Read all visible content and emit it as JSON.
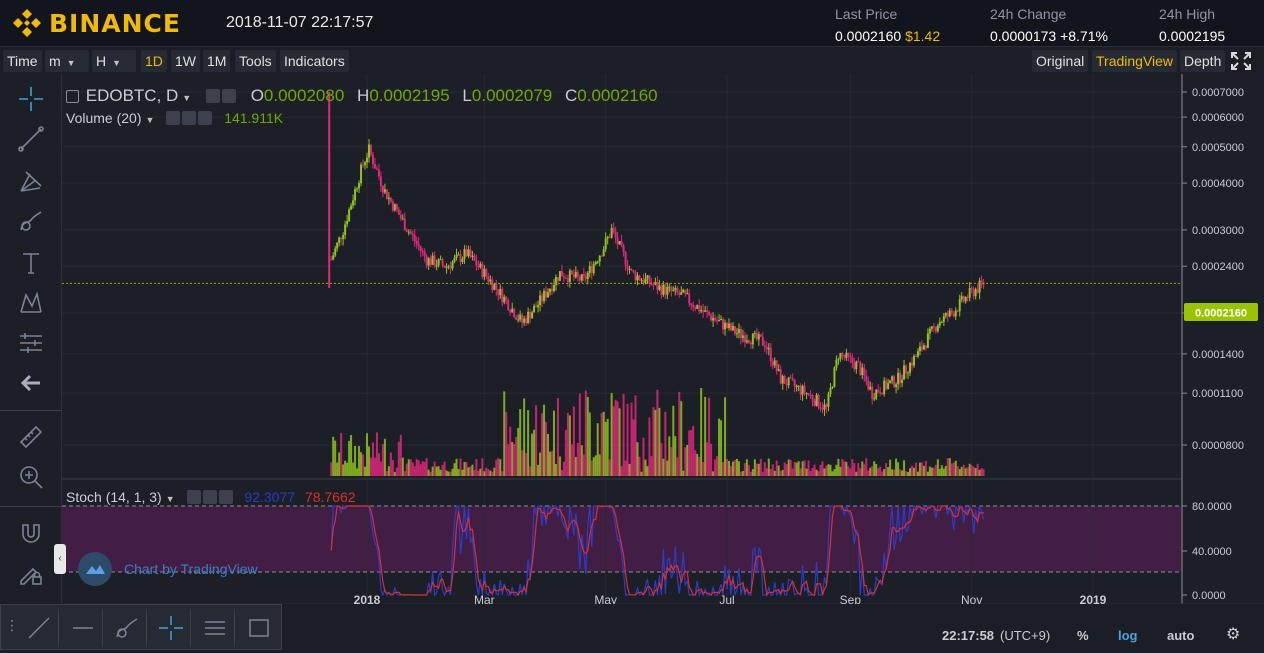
{
  "header": {
    "brand": "BINANCE",
    "datetime": "2018-11-07 22:17:57",
    "last_price_label": "Last Price",
    "last_price": "0.0002160",
    "last_price_usd": "$1.42",
    "change_label": "24h Change",
    "change_value": "0.0000173",
    "change_pct": "+8.71%",
    "high_label": "24h High",
    "high_value": "0.0002195",
    "colors": {
      "brand": "#f0b90b",
      "up": "#70a800",
      "down": "#e0287d"
    }
  },
  "toolbar": {
    "time_label": "Time",
    "minute_label": "m",
    "hour_label": "H",
    "intervals": [
      "1D",
      "1W",
      "1M"
    ],
    "active_interval": "1D",
    "tools_label": "Tools",
    "indicators_label": "Indicators",
    "views": [
      "Original",
      "TradingView",
      "Depth"
    ],
    "active_view": "TradingView"
  },
  "legend": {
    "symbol": "EDOBTC, D",
    "o_label": "O",
    "o_value": "0.0002080",
    "h_label": "H",
    "h_value": "0.0002195",
    "l_label": "L",
    "l_value": "0.0002079",
    "c_label": "C",
    "c_value": "0.0002160",
    "volume_label": "Volume (20)",
    "volume_value": "141.911K",
    "stoch_label": "Stoch (14, 1, 3)",
    "stoch_k": "92.3077",
    "stoch_d": "78.7662"
  },
  "chart_data": {
    "type": "candlestick",
    "price_scale": "log",
    "price_axis_ticks": [
      "0.0007000",
      "0.0006000",
      "0.0005000",
      "0.0004000",
      "0.0003000",
      "0.0002400",
      "0.0001800",
      "0.0001400",
      "0.0001100",
      "0.0000800"
    ],
    "current_price_label": "0.0002160",
    "stoch_axis_ticks": [
      "80.0000",
      "40.0000",
      "0.0000"
    ],
    "time_ticks": [
      "2018",
      "Mar",
      "May",
      "Jul",
      "Sep",
      "Nov",
      "2019"
    ],
    "price_path": [
      [
        "2017-12-13",
        0.0007
      ],
      [
        "2017-12-14",
        0.00025
      ],
      [
        "2017-12-20",
        0.0003
      ],
      [
        "2017-12-30",
        0.00045
      ],
      [
        "2018-01-02",
        0.00049
      ],
      [
        "2018-01-10",
        0.00038
      ],
      [
        "2018-01-20",
        0.00031
      ],
      [
        "2018-01-31",
        0.00025
      ],
      [
        "2018-02-10",
        0.00024
      ],
      [
        "2018-02-20",
        0.00026
      ],
      [
        "2018-03-01",
        0.00023
      ],
      [
        "2018-03-10",
        0.0002
      ],
      [
        "2018-03-20",
        0.00017
      ],
      [
        "2018-03-28",
        0.00019
      ],
      [
        "2018-04-08",
        0.00023
      ],
      [
        "2018-04-20",
        0.00022
      ],
      [
        "2018-04-30",
        0.00027
      ],
      [
        "2018-05-04",
        0.0003
      ],
      [
        "2018-05-14",
        0.00023
      ],
      [
        "2018-05-28",
        0.00021
      ],
      [
        "2018-06-09",
        0.0002
      ],
      [
        "2018-06-20",
        0.00018
      ],
      [
        "2018-07-05",
        0.00016
      ],
      [
        "2018-07-20",
        0.00015
      ],
      [
        "2018-07-28",
        0.00012
      ],
      [
        "2018-08-10",
        0.00011
      ],
      [
        "2018-08-20",
        0.0001
      ],
      [
        "2018-08-26",
        0.00014
      ],
      [
        "2018-09-05",
        0.00013
      ],
      [
        "2018-09-12",
        0.00011
      ],
      [
        "2018-09-25",
        0.00012
      ],
      [
        "2018-10-05",
        0.00014
      ],
      [
        "2018-10-15",
        0.00017
      ],
      [
        "2018-10-22",
        0.00018
      ],
      [
        "2018-10-30",
        0.0002
      ],
      [
        "2018-11-07",
        0.000216
      ]
    ]
  },
  "watermark": "Chart by TradingView",
  "bottombar": {
    "clock": "22:17:58",
    "timezone": "(UTC+9)",
    "percent_label": "%",
    "log_label": "log",
    "auto_label": "auto"
  }
}
